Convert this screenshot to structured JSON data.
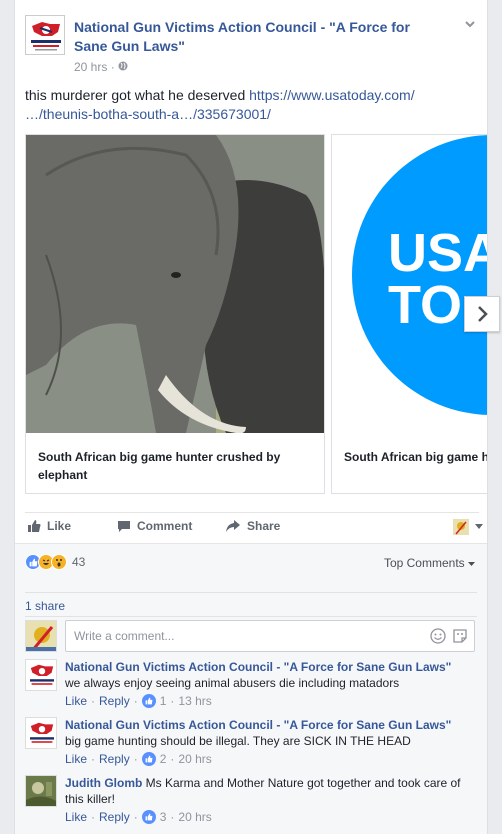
{
  "post": {
    "page_name": "National Gun Victims Action Council - \"A Force for Sane Gun Laws\"",
    "time": "20 hrs",
    "sep": "·",
    "text": "this murderer got what he deserved ",
    "link_line1": "https://www.usatoday.com/",
    "link_line2": "…/theunis-botha-south-a…/335673001/"
  },
  "cards": [
    {
      "caption": "South African big game hunter crushed by elephant"
    },
    {
      "caption": "South African big game hunter crushed by elephant",
      "logo_line1": "USA",
      "logo_line2": "TO"
    }
  ],
  "actions": {
    "like": "Like",
    "comment": "Comment",
    "share": "Share"
  },
  "reactions": {
    "count": "43",
    "top_comments": "Top Comments",
    "shares": "1 share"
  },
  "composer": {
    "placeholder": "Write a comment..."
  },
  "comments": [
    {
      "author": "National Gun Victims Action Council - \"A Force for Sane Gun Laws\"",
      "text": "we always enjoy seeing animal abusers die including matadors",
      "like": "Like",
      "reply": "Reply",
      "count": "1",
      "time": "13 hrs"
    },
    {
      "author": "National Gun Victims Action Council - \"A Force for Sane Gun Laws\"",
      "text": "big game hunting should be illegal. They are SICK IN THE HEAD",
      "like": "Like",
      "reply": "Reply",
      "count": "2",
      "time": "20 hrs"
    },
    {
      "author": "Judith Glomb",
      "text": "Ms Karma and Mother Nature got together and took care of this killer!",
      "like": "Like",
      "reply": "Reply",
      "count": "3",
      "time": "20 hrs"
    }
  ],
  "colors": {
    "link": "#365899",
    "usa_blue": "#009bff",
    "reaction_blue": "#5890ff"
  }
}
